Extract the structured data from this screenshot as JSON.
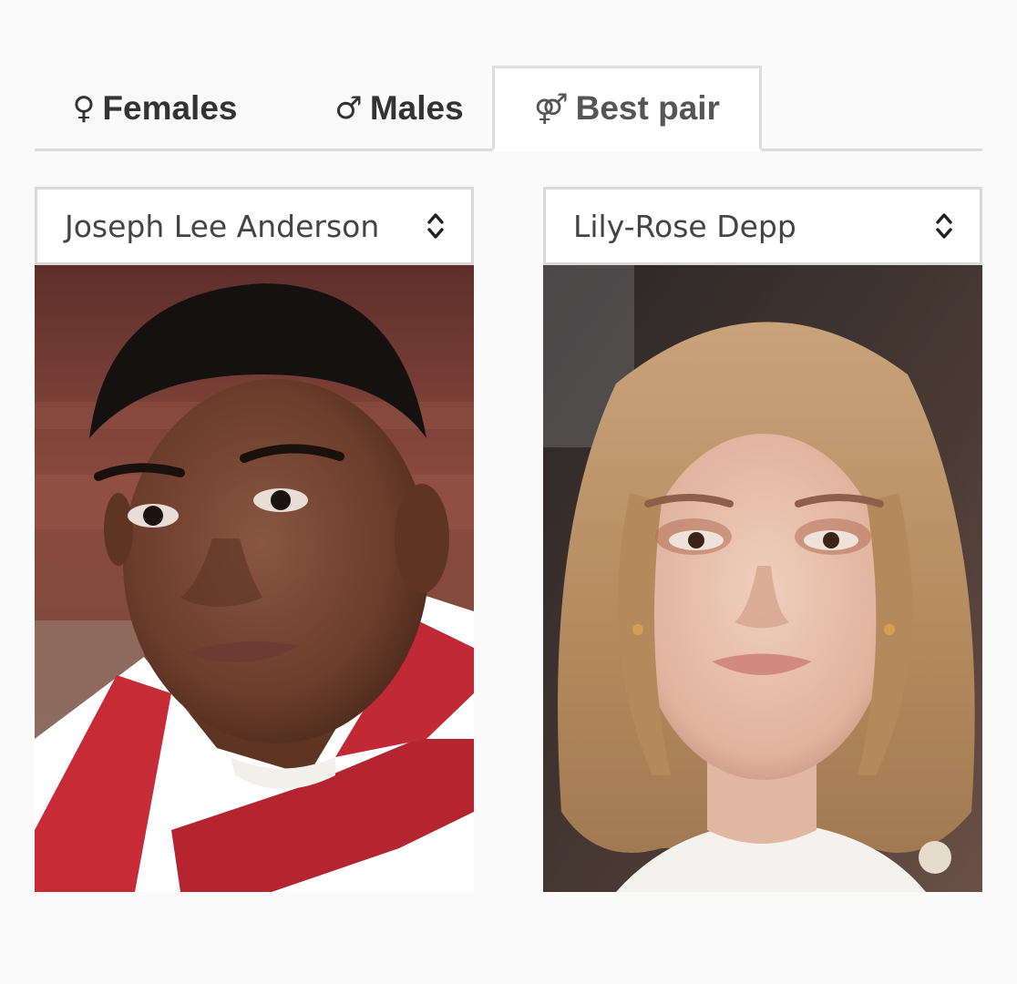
{
  "tabs": [
    {
      "symbol": "♀",
      "label": "Females",
      "active": false
    },
    {
      "symbol": "♂",
      "label": "Males",
      "active": false
    },
    {
      "symbol": "⚤",
      "label": "Best pair",
      "active": true
    }
  ],
  "pair": {
    "left": {
      "selected": "Joseph Lee Anderson",
      "photo": "male-portrait"
    },
    "right": {
      "selected": "Lily-Rose Depp",
      "photo": "female-portrait"
    }
  },
  "colors": {
    "background": "#fafafa",
    "border": "#dddddd",
    "tab_text": "#333333",
    "select_text": "#444444"
  }
}
